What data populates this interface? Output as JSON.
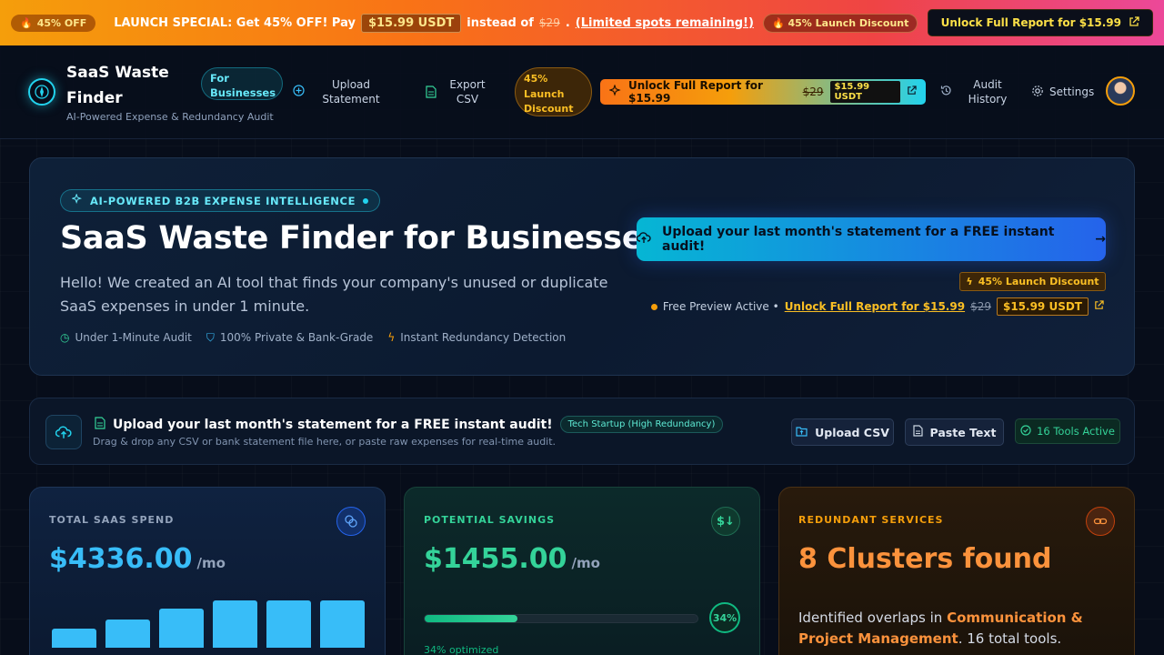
{
  "promo": {
    "badge": "45% OFF",
    "text_before": "LAUNCH SPECIAL: Get 45% OFF! Pay",
    "price": "$15.99 USDT",
    "text_mid": "instead of",
    "old_price": "$29",
    "link": "(Limited spots remaining!)",
    "discount": "45% Launch Discount",
    "cta": "Unlock Full Report for $15.99"
  },
  "nav": {
    "brand_title": "SaaS Waste Finder",
    "brand_sub": "AI-Powered Expense & Redundancy Audit",
    "for_business": "For Businesses",
    "upload_label": "Upload Statement",
    "export_label": "Export CSV",
    "discount_pill": "45% Launch Discount",
    "unlock_label": "Unlock Full Report for $15.99",
    "unlock_old": "$29",
    "unlock_price": "$15.99 USDT",
    "history_label": "Audit History",
    "settings_label": "Settings"
  },
  "hero": {
    "tag": "AI-POWERED B2B EXPENSE INTELLIGENCE",
    "title": "SaaS Waste Finder for Businesses",
    "description": "Hello! We created an AI tool that finds your company's unused or duplicate SaaS expenses in under 1 minute.",
    "features": [
      "Under 1-Minute Audit",
      "100% Private & Bank-Grade",
      "Instant Redundancy Detection"
    ],
    "cta": "Upload your last month's statement for a FREE instant audit!",
    "discount": "45% Launch Discount",
    "preview_text": "Free Preview Active •",
    "preview_link": "Unlock Full Report for $15.99",
    "preview_old": "$29",
    "preview_price": "$15.99 USDT"
  },
  "upload": {
    "title": "Upload your last month's statement for a FREE instant audit!",
    "chip": "Tech Startup (High Redundancy)",
    "subtitle": "Drag & drop any CSV or bank statement file here, or paste raw expenses for real-time audit.",
    "csv_button": "Upload CSV",
    "paste_button": "Paste Text",
    "tools_active": "16 Tools Active"
  },
  "cards": {
    "spend": {
      "label": "TOTAL SAAS SPEND",
      "value": "$4336.00",
      "unit": "/mo",
      "trend": [
        0.4,
        0.6,
        0.82,
        1.0,
        1.0,
        1.0
      ],
      "color": "#38bdf8"
    },
    "savings": {
      "label": "POTENTIAL SAVINGS",
      "value": "$1455.00",
      "unit": "/mo",
      "percent": 34,
      "percent_label": "34%",
      "note": "34% optimized",
      "color": "#34d399"
    },
    "redundant": {
      "label": "REDUNDANT SERVICES",
      "value": "8 Clusters found",
      "desc_prefix": "Identified overlaps in",
      "desc_highlight": "Communication & Project Management",
      "desc_suffix": ". 16 total tools.",
      "color": "#fb923c"
    }
  }
}
